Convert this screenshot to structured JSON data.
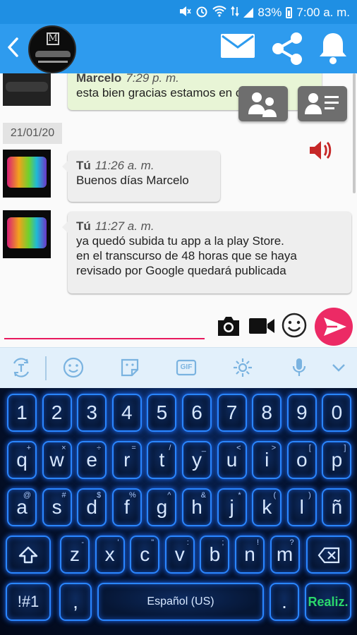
{
  "status_bar": {
    "battery": "83%",
    "time": "7:00 a. m."
  },
  "app_bar": {
    "back_icon": "chevron-left-icon",
    "logo": "company-logo",
    "actions": [
      "mail-icon",
      "share-icon",
      "bell-icon"
    ]
  },
  "chat": {
    "messages": [
      {
        "sender": "Marcelo",
        "time": "7:29 p. m.",
        "text": "esta bien gracias estamos en contacto",
        "style": "received"
      },
      {
        "sender": "Tú",
        "time": "11:26 a. m.",
        "text": "Buenos días Marcelo",
        "style": "sent"
      },
      {
        "sender": "Tú",
        "time": "11:27 a. m.",
        "text_lines": [
          "ya quedó subida tu app a la play Store.",
          "en el transcurso de 48 horas que se haya",
          "revisado por Google quedará publicada"
        ],
        "style": "sent"
      }
    ],
    "date_chip": "21/01/20",
    "floating_actions": [
      "group-icon",
      "contact-card-icon"
    ]
  },
  "composer": {
    "value": "",
    "placeholder": "",
    "icons": [
      "camera-icon",
      "video-icon",
      "emoji-icon",
      "send-icon"
    ]
  },
  "keyboard_toolbar": {
    "icons": [
      "translate-icon",
      "emoji-icon",
      "sticker-icon",
      "gif-icon",
      "settings-icon",
      "mic-icon",
      "chevron-down-icon"
    ],
    "gif_label": "GIF"
  },
  "keyboard": {
    "row_numbers": [
      "1",
      "2",
      "3",
      "4",
      "5",
      "6",
      "7",
      "8",
      "9",
      "0"
    ],
    "row_q": [
      {
        "k": "q",
        "s": "+"
      },
      {
        "k": "w",
        "s": "×"
      },
      {
        "k": "e",
        "s": "÷"
      },
      {
        "k": "r",
        "s": "="
      },
      {
        "k": "t",
        "s": "/"
      },
      {
        "k": "y",
        "s": "_"
      },
      {
        "k": "u",
        "s": "<"
      },
      {
        "k": "i",
        "s": ">"
      },
      {
        "k": "o",
        "s": "["
      },
      {
        "k": "p",
        "s": "]"
      }
    ],
    "row_a": [
      {
        "k": "a",
        "s": "@"
      },
      {
        "k": "s",
        "s": "#"
      },
      {
        "k": "d",
        "s": "$"
      },
      {
        "k": "f",
        "s": "%"
      },
      {
        "k": "g",
        "s": "^"
      },
      {
        "k": "h",
        "s": "&"
      },
      {
        "k": "j",
        "s": "*"
      },
      {
        "k": "k",
        "s": "("
      },
      {
        "k": "l",
        "s": ")"
      },
      {
        "k": "ñ",
        "s": ""
      }
    ],
    "row_z": [
      {
        "k": "z",
        "s": "-"
      },
      {
        "k": "x",
        "s": "'"
      },
      {
        "k": "c",
        "s": "\""
      },
      {
        "k": "v",
        "s": ":"
      },
      {
        "k": "b",
        "s": ";"
      },
      {
        "k": "n",
        "s": "!"
      },
      {
        "k": "m",
        "s": "?"
      }
    ],
    "shift_icon": "shift-icon",
    "backspace_icon": "backspace-icon",
    "symbols_label": "!#1",
    "comma_label": ",",
    "space_label": "Español (US)",
    "period_label": ".",
    "done_label": "Realiz."
  },
  "colors": {
    "primary": "#2e9bee",
    "accent": "#ec2a65",
    "keyboard_glow": "#2a86ff",
    "done_green": "#2bd86b"
  }
}
